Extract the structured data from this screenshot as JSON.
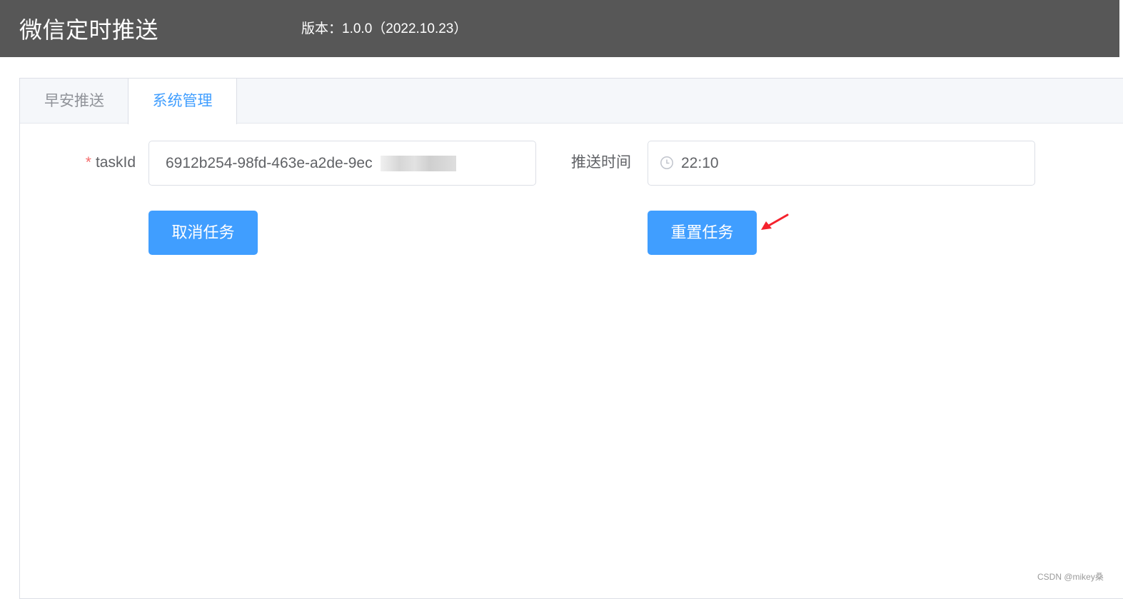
{
  "header": {
    "app_title": "微信定时推送",
    "version": "版本：1.0.0（2022.10.23）"
  },
  "tabs": [
    {
      "label": "早安推送",
      "active": false
    },
    {
      "label": "系统管理",
      "active": true
    }
  ],
  "form": {
    "taskid_label": "taskId",
    "taskid_required_mark": "*",
    "taskid_value": "6912b254-98fd-463e-a2de-9ec",
    "push_time_label": "推送时间",
    "push_time_value": "22:10",
    "cancel_button": "取消任务",
    "reset_button": "重置任务"
  },
  "icons": {
    "time_input": "clock-icon",
    "annotation": "red-arrow-icon"
  },
  "colors": {
    "header_bg": "#575757",
    "primary": "#409eff",
    "required": "#f56c6c",
    "annotation_arrow": "#f5222d"
  },
  "watermark": "CSDN @mikey桑"
}
